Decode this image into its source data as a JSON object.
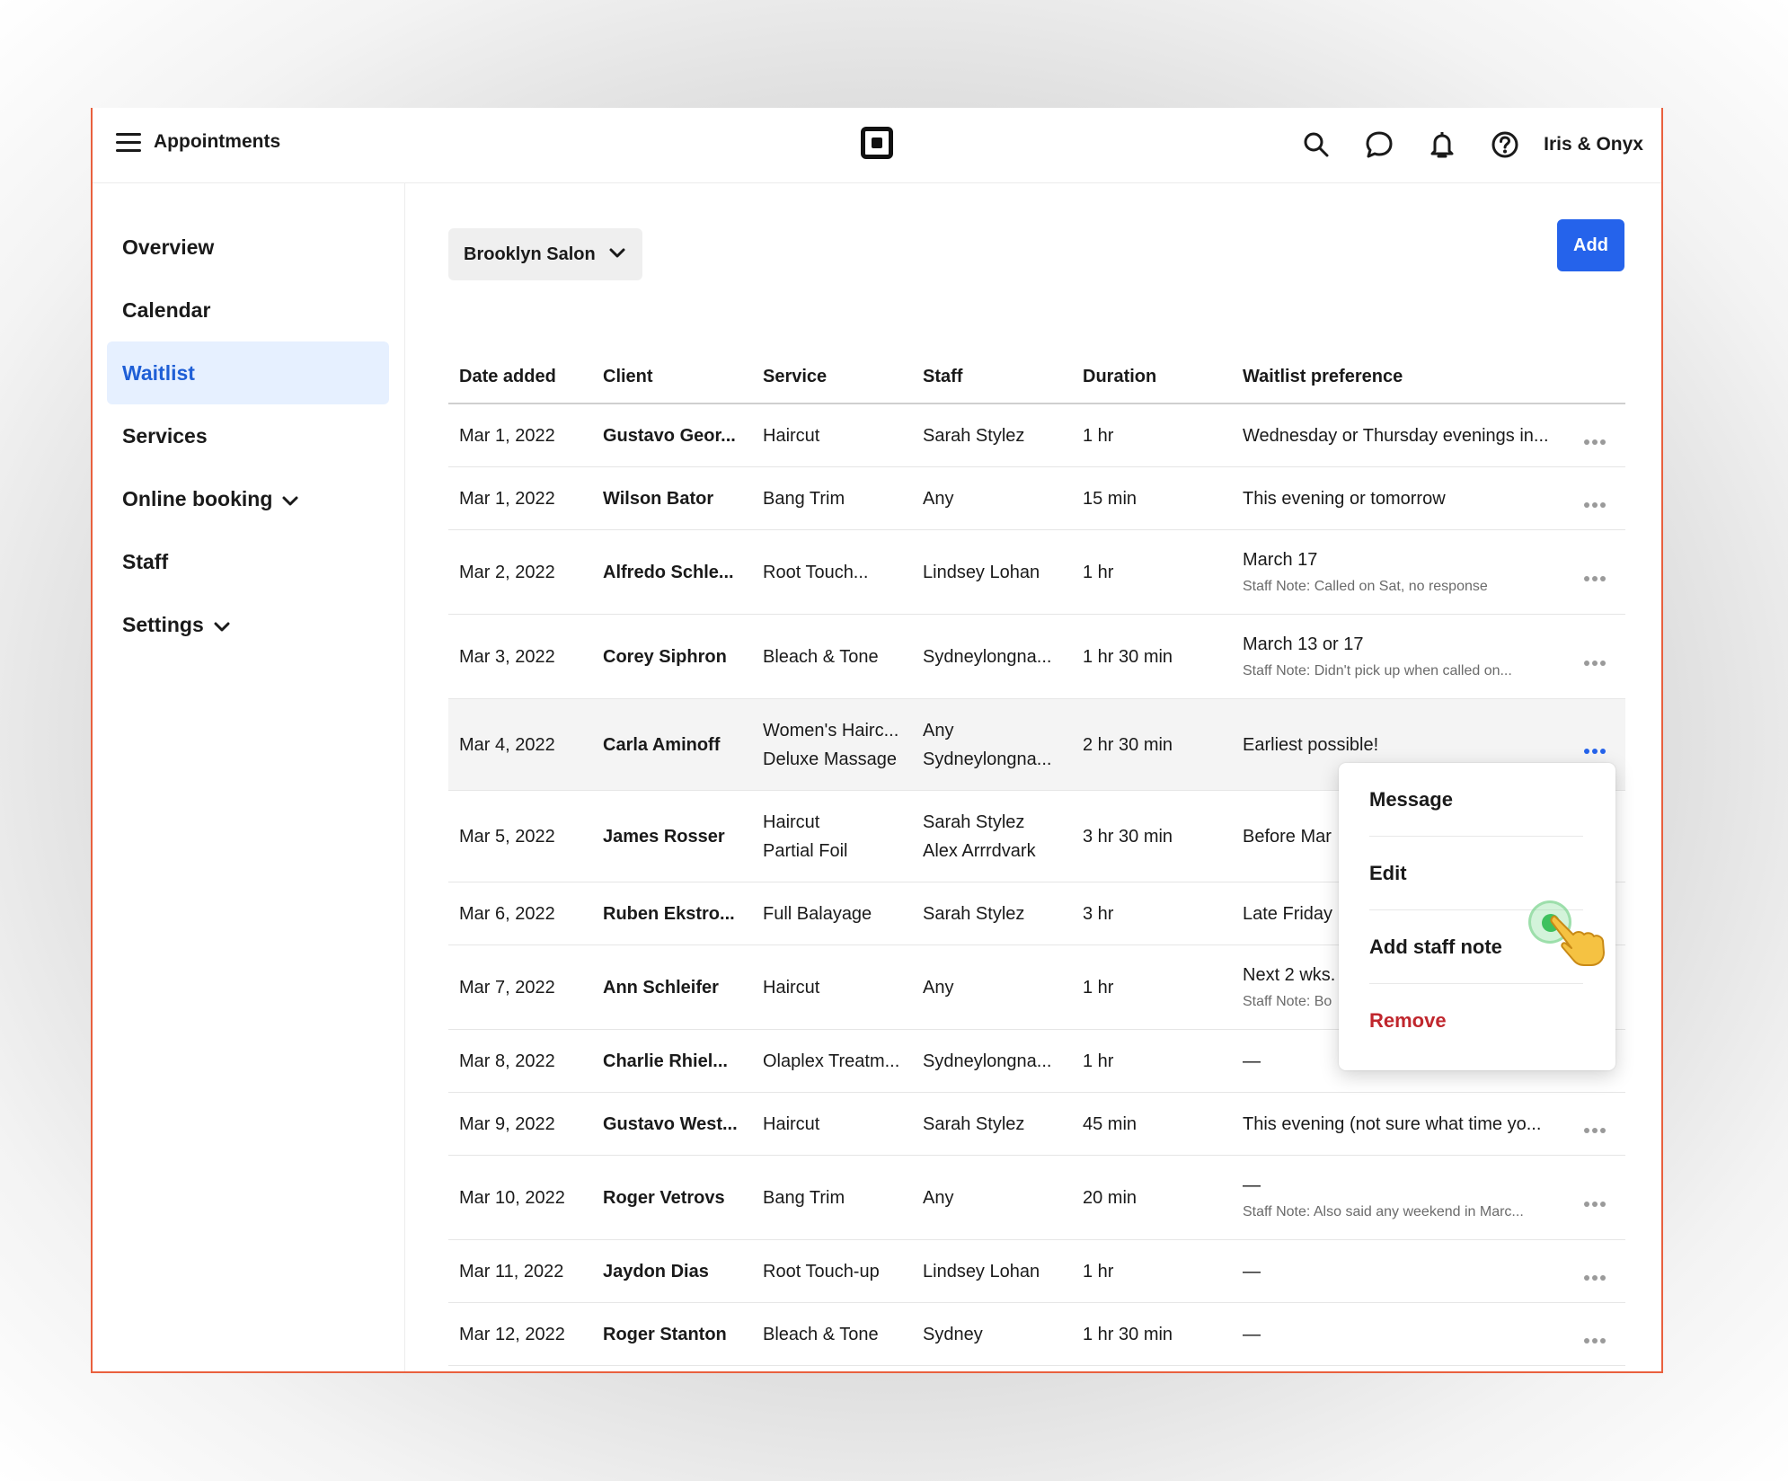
{
  "header": {
    "app_title": "Appointments",
    "account_name": "Iris & Onyx",
    "icons": [
      "menu-icon",
      "square-logo-icon",
      "search-icon",
      "chat-icon",
      "bell-icon",
      "help-icon"
    ]
  },
  "sidebar": {
    "items": [
      {
        "label": "Overview"
      },
      {
        "label": "Calendar"
      },
      {
        "label": "Waitlist",
        "active": true
      },
      {
        "label": "Services"
      },
      {
        "label": "Online booking",
        "has_chevron": true
      },
      {
        "label": "Staff"
      },
      {
        "label": "Settings",
        "has_chevron": true
      }
    ]
  },
  "toolbar": {
    "location": "Brooklyn Salon",
    "add_label": "Add"
  },
  "table": {
    "columns": [
      "Date added",
      "Client",
      "Service",
      "Staff",
      "Duration",
      "Waitlist preference"
    ],
    "rows": [
      {
        "date": "Mar 1, 2022",
        "client": "Gustavo Geor...",
        "service": [
          "Haircut"
        ],
        "staff": [
          "Sarah Stylez"
        ],
        "duration": "1 hr",
        "pref": "Wednesday or Thursday evenings in...",
        "note": ""
      },
      {
        "date": "Mar 1, 2022",
        "client": "Wilson Bator",
        "service": [
          "Bang Trim"
        ],
        "staff": [
          "Any"
        ],
        "duration": "15 min",
        "pref": "This evening or tomorrow",
        "note": ""
      },
      {
        "date": "Mar 2, 2022",
        "client": "Alfredo Schle...",
        "service": [
          "Root Touch..."
        ],
        "staff": [
          "Lindsey Lohan"
        ],
        "duration": "1 hr",
        "pref": "March 17",
        "note": "Staff Note: Called on Sat, no response"
      },
      {
        "date": "Mar 3, 2022",
        "client": "Corey Siphron",
        "service": [
          "Bleach & Tone"
        ],
        "staff": [
          "Sydneylongna..."
        ],
        "duration": "1 hr 30 min",
        "pref": "March 13 or 17",
        "note": "Staff Note: Didn't pick up when called on..."
      },
      {
        "date": "Mar 4, 2022",
        "client": "Carla Aminoff",
        "service": [
          "Women's Hairc...",
          "Deluxe Massage"
        ],
        "staff": [
          "Any",
          "Sydneylongna..."
        ],
        "duration": "2 hr 30 min",
        "pref": "Earliest possible!",
        "note": "",
        "highlighted": true
      },
      {
        "date": "Mar 5, 2022",
        "client": "James Rosser",
        "service": [
          "Haircut",
          "Partial Foil"
        ],
        "staff": [
          "Sarah Stylez",
          "Alex Arrrdvark"
        ],
        "duration": "3 hr 30 min",
        "pref": "Before Mar",
        "note": ""
      },
      {
        "date": "Mar 6, 2022",
        "client": "Ruben Ekstro...",
        "service": [
          "Full Balayage"
        ],
        "staff": [
          "Sarah Stylez"
        ],
        "duration": "3 hr",
        "pref": "Late Friday",
        "note": ""
      },
      {
        "date": "Mar 7, 2022",
        "client": "Ann Schleifer",
        "service": [
          "Haircut"
        ],
        "staff": [
          "Any"
        ],
        "duration": "1 hr",
        "pref": "Next 2 wks.",
        "note": "Staff Note: Bo"
      },
      {
        "date": "Mar 8, 2022",
        "client": "Charlie Rhiel...",
        "service": [
          "Olaplex Treatm..."
        ],
        "staff": [
          "Sydneylongna..."
        ],
        "duration": "1 hr",
        "pref": "—",
        "note": ""
      },
      {
        "date": "Mar 9, 2022",
        "client": "Gustavo West...",
        "service": [
          "Haircut"
        ],
        "staff": [
          "Sarah Stylez"
        ],
        "duration": "45 min",
        "pref": "This evening (not sure what time yo...",
        "note": ""
      },
      {
        "date": "Mar 10, 2022",
        "client": "Roger Vetrovs",
        "service": [
          "Bang Trim"
        ],
        "staff": [
          "Any"
        ],
        "duration": "20 min",
        "pref": "—",
        "note": "Staff Note: Also said any weekend in Marc..."
      },
      {
        "date": "Mar 11, 2022",
        "client": "Jaydon Dias",
        "service": [
          "Root Touch-up"
        ],
        "staff": [
          "Lindsey Lohan"
        ],
        "duration": "1 hr",
        "pref": "—",
        "note": ""
      },
      {
        "date": "Mar 12, 2022",
        "client": "Roger Stanton",
        "service": [
          "Bleach & Tone"
        ],
        "staff": [
          "Sydney"
        ],
        "duration": "1 hr 30 min",
        "pref": "—",
        "note": ""
      }
    ]
  },
  "context_menu": {
    "items": [
      {
        "label": "Message"
      },
      {
        "label": "Edit"
      },
      {
        "label": "Add staff note"
      },
      {
        "label": "Remove",
        "danger": true
      }
    ]
  },
  "colors": {
    "accent": "#2563eb",
    "active_nav_bg": "#e6f0ff",
    "active_nav_text": "#1f5fd6",
    "danger": "#c0262d",
    "window_border": "#e9603e"
  }
}
